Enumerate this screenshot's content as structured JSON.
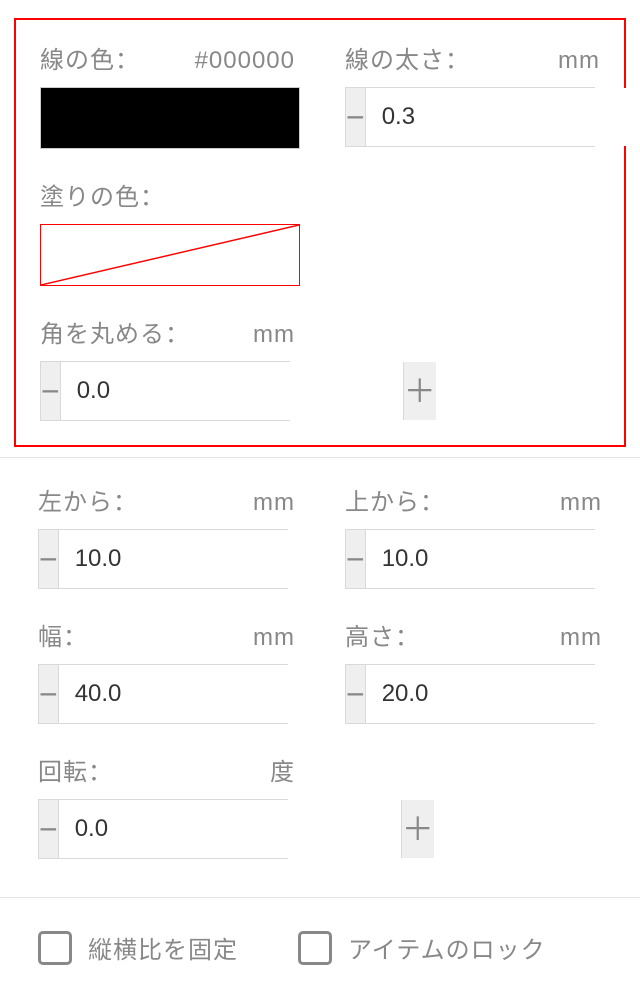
{
  "appearance": {
    "lineColor": {
      "label": "線の色：",
      "value": "#000000"
    },
    "lineWidth": {
      "label": "線の太さ：",
      "unit": "mm",
      "value": "0.3"
    },
    "fillColor": {
      "label": "塗りの色："
    },
    "cornerRadius": {
      "label": "角を丸める：",
      "unit": "mm",
      "value": "0.0"
    }
  },
  "position": {
    "fromLeft": {
      "label": "左から：",
      "unit": "mm",
      "value": "10.0"
    },
    "fromTop": {
      "label": "上から：",
      "unit": "mm",
      "value": "10.0"
    },
    "width": {
      "label": "幅：",
      "unit": "mm",
      "value": "40.0"
    },
    "height": {
      "label": "高さ：",
      "unit": "mm",
      "value": "20.0"
    },
    "rotation": {
      "label": "回転：",
      "unit": "度",
      "value": "0.0"
    }
  },
  "options": {
    "lockAspect": {
      "label": "縦横比を固定"
    },
    "lockItem": {
      "label": "アイテムのロック"
    }
  },
  "glyphs": {
    "minus": "−",
    "plus": "＋"
  }
}
